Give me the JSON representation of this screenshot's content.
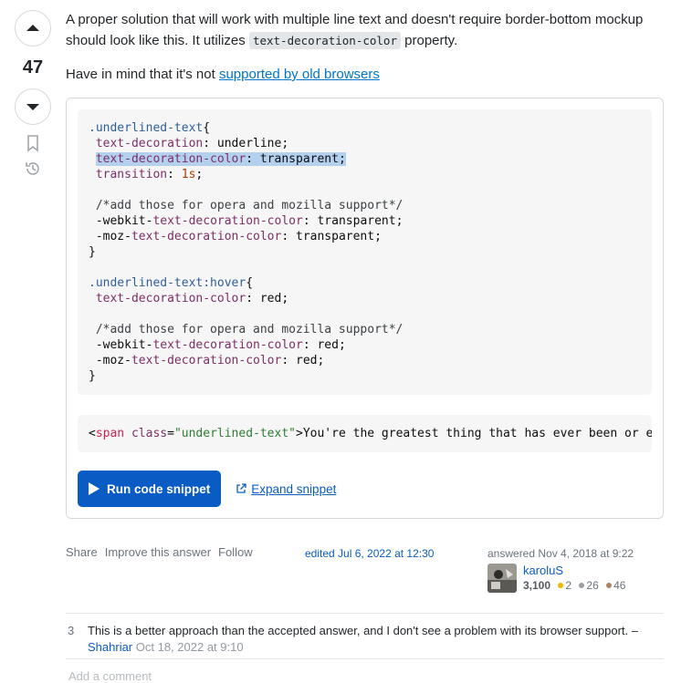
{
  "vote": {
    "count": "47"
  },
  "answer": {
    "p1_a": "A proper solution that will work with multiple line text and doesn't require border-bottom mockup should look like this. It utilizes ",
    "p1_code": "text-decoration-color",
    "p1_b": " property.",
    "p2_a": "Have in mind that it's not ",
    "p2_link": "supported by old browsers"
  },
  "snippet": {
    "run_label": "Run code snippet",
    "expand_label": "Expand snippet",
    "html_line": {
      "lt": "<",
      "tag": "span",
      "attr": "class",
      "eq": "=",
      "val": "\"underlined-text\"",
      "text": ">You're the greatest thing that has ever been or e"
    }
  },
  "post_menu": {
    "share": "Share",
    "improve": "Improve this answer",
    "follow": "Follow"
  },
  "edited": "edited Jul 6, 2022 at 12:30",
  "user": {
    "answered": "answered Nov 4, 2018 at 9:22",
    "name": "karoluS",
    "rep": "3,100",
    "gold": "2",
    "silver": "26",
    "bronze": "46"
  },
  "comment": {
    "score": "3",
    "text": "This is a better approach than the accepted answer, and I don't see a problem with its browser support. – ",
    "user": "Shahriar",
    "date": "Oct 18, 2022 at 9:10"
  },
  "add_comment": "Add a comment",
  "colors": {
    "accent": "#0a5cc5",
    "gold": "#f1b600",
    "silver": "#9a9ea2",
    "bronze": "#ab825f"
  }
}
